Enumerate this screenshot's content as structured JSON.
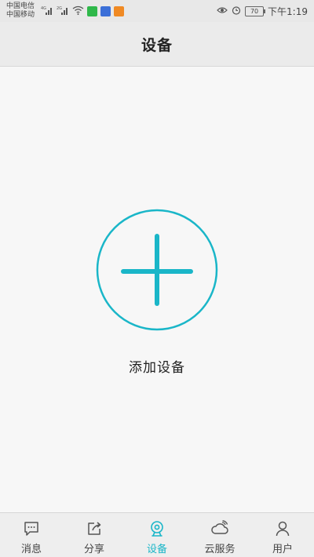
{
  "status_bar": {
    "carrier_1": "中国电信",
    "carrier_2": "中国移动",
    "net_1": "4G",
    "net_2": "2G",
    "battery": "70",
    "time": "下午1:19"
  },
  "header": {
    "title": "设备"
  },
  "main": {
    "add_device_label": "添加设备",
    "accent_color": "#1ab6c8"
  },
  "bottom_nav": {
    "items": [
      {
        "label": "消息",
        "icon": "message-icon",
        "active": false
      },
      {
        "label": "分享",
        "icon": "share-icon",
        "active": false
      },
      {
        "label": "设备",
        "icon": "camera-icon",
        "active": true
      },
      {
        "label": "云服务",
        "icon": "cloud-icon",
        "active": false
      },
      {
        "label": "用户",
        "icon": "user-icon",
        "active": false
      }
    ]
  }
}
